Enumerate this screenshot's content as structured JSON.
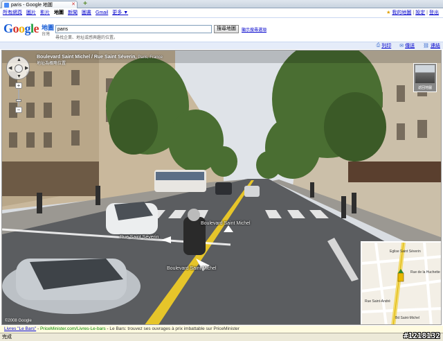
{
  "browser": {
    "tab_title": "paris - Google 地圖",
    "new_tab": "+"
  },
  "gbar": {
    "links": [
      "所有網頁",
      "圖片",
      "影片",
      "地圖",
      "新聞",
      "圖書",
      "Gmail",
      "更多 ▼"
    ],
    "active_index": 3,
    "right": {
      "starred": "我的地圖",
      "settings": "設定",
      "signout": "登出"
    }
  },
  "header": {
    "logo": "Google",
    "logo_sub": "地圖",
    "logo_region": "台灣",
    "search_value": "paris",
    "search_hint": "尋找企業、地址或感興趣的位置。",
    "search_button": "搜尋地圖",
    "options_link": "顯示搜尋選項"
  },
  "mapbar": {
    "print": "列印",
    "send": "傳送",
    "link": "連結"
  },
  "streetview": {
    "address": "Boulevard Saint Michel / Rue Saint Séverin,",
    "city": "Paris, France",
    "address_sub": "地址為概略位置",
    "thumbnail_label": "返回地圖",
    "labels": {
      "road1": "Boulevard Saint Michel",
      "road2": "Rue Saint Séverin",
      "road3": "Boulevard Saint Michel"
    },
    "copyright": "©2008 Google",
    "minimap_labels": [
      "Eglise Saint Séverin",
      "Rue de la Huchette",
      "Rue Saint-André",
      "Bd Saint-Michel"
    ]
  },
  "ad": {
    "title": "Livres \"Le Bars\"",
    "url": "PriceMinister.com/Livres-Le-bars",
    "text": "Le Bars: trouvez ses ouvrages à prix imbattable sur PriceMinister"
  },
  "status": {
    "text": "完成",
    "watermark": "#1218132"
  },
  "colors": {
    "link": "#0000cc",
    "mapbar_bg": "#e5ecf9",
    "road_line": "#e6c52a",
    "marker": "#e8b800"
  }
}
